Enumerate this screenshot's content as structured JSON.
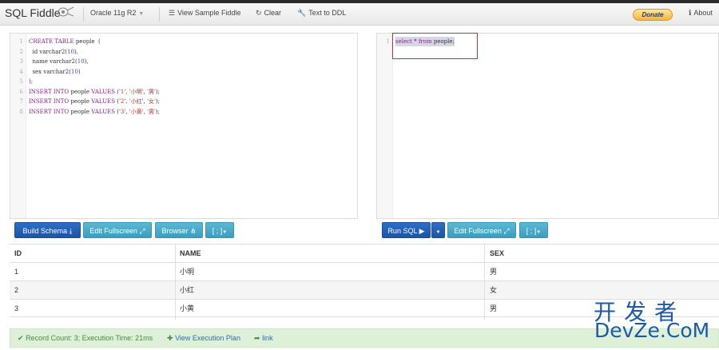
{
  "navbar": {
    "brand": "SQL Fiddle",
    "db_version": "Oracle 11g R2",
    "view_sample": "View Sample Fiddle",
    "clear": "Clear",
    "text_to_ddl": "Text to DDL",
    "donate": "Donate",
    "about": "About"
  },
  "schema_editor": {
    "lines": [
      {
        "n": "1",
        "parts": [
          {
            "t": "CREATE TABLE",
            "c": "kw"
          },
          {
            "t": " people  (",
            "c": ""
          }
        ]
      },
      {
        "n": "2",
        "parts": [
          {
            "t": "  id varchar2(",
            "c": ""
          },
          {
            "t": "10",
            "c": "num"
          },
          {
            "t": "),",
            "c": ""
          }
        ]
      },
      {
        "n": "3",
        "parts": [
          {
            "t": "  name varchar2(",
            "c": ""
          },
          {
            "t": "10",
            "c": "num"
          },
          {
            "t": "),",
            "c": ""
          }
        ]
      },
      {
        "n": "4",
        "parts": [
          {
            "t": "  sex varchar2(",
            "c": ""
          },
          {
            "t": "10",
            "c": "num"
          },
          {
            "t": ")",
            "c": ""
          }
        ]
      },
      {
        "n": "5",
        "parts": [
          {
            "t": ");",
            "c": ""
          }
        ]
      },
      {
        "n": "6",
        "parts": [
          {
            "t": "INSERT INTO",
            "c": "kw"
          },
          {
            "t": " people ",
            "c": ""
          },
          {
            "t": "VALUES",
            "c": "kw"
          },
          {
            "t": " (",
            "c": ""
          },
          {
            "t": "'1'",
            "c": "str"
          },
          {
            "t": ", ",
            "c": ""
          },
          {
            "t": "'小明'",
            "c": "str"
          },
          {
            "t": ", ",
            "c": ""
          },
          {
            "t": "'男'",
            "c": "str"
          },
          {
            "t": ");",
            "c": ""
          }
        ]
      },
      {
        "n": "7",
        "parts": [
          {
            "t": "INSERT INTO",
            "c": "kw"
          },
          {
            "t": " people ",
            "c": ""
          },
          {
            "t": "VALUES",
            "c": "kw"
          },
          {
            "t": " (",
            "c": ""
          },
          {
            "t": "'2'",
            "c": "str"
          },
          {
            "t": ", ",
            "c": ""
          },
          {
            "t": "'小红'",
            "c": "str"
          },
          {
            "t": ", ",
            "c": ""
          },
          {
            "t": "'女'",
            "c": "str"
          },
          {
            "t": ");",
            "c": ""
          }
        ]
      },
      {
        "n": "8",
        "parts": [
          {
            "t": "INSERT INTO",
            "c": "kw"
          },
          {
            "t": " people ",
            "c": ""
          },
          {
            "t": "VALUES",
            "c": "kw"
          },
          {
            "t": " (",
            "c": ""
          },
          {
            "t": "'3'",
            "c": "str"
          },
          {
            "t": ", ",
            "c": ""
          },
          {
            "t": "'小黄'",
            "c": "str"
          },
          {
            "t": ", ",
            "c": ""
          },
          {
            "t": "'男'",
            "c": "str"
          },
          {
            "t": ");",
            "c": ""
          }
        ]
      }
    ]
  },
  "query_editor": {
    "lines": [
      {
        "n": "1",
        "parts": [
          {
            "t": "select",
            "c": "kw"
          },
          {
            "t": " * ",
            "c": ""
          },
          {
            "t": "from",
            "c": "kw"
          },
          {
            "t": " people;",
            "c": ""
          }
        ]
      }
    ]
  },
  "schema_buttons": {
    "build": "Build Schema",
    "fullscreen": "Edit Fullscreen",
    "browser": "Browser",
    "delim": "[ ; ]"
  },
  "query_buttons": {
    "run": "Run SQL",
    "fullscreen": "Edit Fullscreen",
    "delim": "[ ; ]"
  },
  "results": {
    "columns": [
      "ID",
      "NAME",
      "SEX"
    ],
    "rows": [
      [
        "1",
        "小明",
        "男"
      ],
      [
        "2",
        "小红",
        "女"
      ],
      [
        "3",
        "小黄",
        "男"
      ]
    ]
  },
  "status": {
    "record_info": "Record Count: 3; Execution Time: 21ms",
    "view_plan": "View Execution Plan",
    "link": "link"
  },
  "watermark": {
    "line1": "开发者",
    "line2": "DevZe.CoM"
  },
  "colors": {
    "primary_button": "#1c54a8",
    "info_button": "#3a9ec0",
    "keyword": "#8a1e8e",
    "string": "#b5332a",
    "number": "#2b58a6",
    "status_bg": "#dff0d8",
    "highlight_box": "#d42a2a"
  }
}
